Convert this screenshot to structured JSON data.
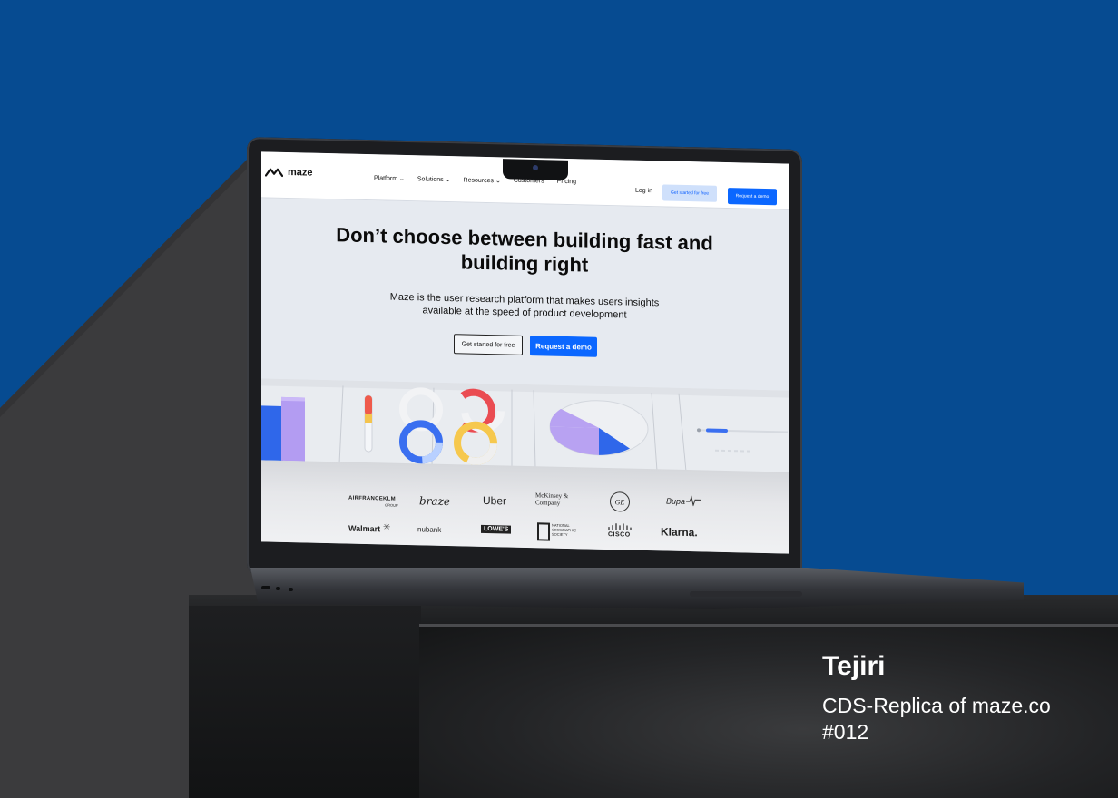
{
  "site": {
    "logo": "maze",
    "nav": [
      "Platform",
      "Solutions",
      "Resources",
      "Customers",
      "Pricing"
    ],
    "nav_dropdown_flags": [
      true,
      true,
      true,
      false,
      false
    ],
    "login": "Log in",
    "cta_ghost": "Get started for free",
    "cta_primary": "Request a demo",
    "hero_title_line1": "Don’t choose between building fast and",
    "hero_title_line2": "building right",
    "hero_sub_line1": "Maze is the user research platform that makes users insights",
    "hero_sub_line2": "available at the speed of product development",
    "hero_btn_outline": "Get started for free",
    "hero_btn_primary": "Request a  demo",
    "brands_row1": [
      "AIRFRANCEKLM",
      "braze",
      "Uber",
      "McKinsey & Company",
      "GE",
      "Bupa"
    ],
    "brands_row2": [
      "Walmart",
      "nubank",
      "LOWE'S",
      "NATIONAL GEOGRAPHIC SOCIETY",
      "CISCO",
      "Klarna."
    ],
    "brand_subtexts": {
      "airfrance": "GROUP"
    }
  },
  "caption": {
    "author": "Tejiri",
    "line1": "CDS-Replica of maze.co",
    "line2": "#012"
  },
  "colors": {
    "background": "#064b91",
    "accent": "#0b67ff",
    "screen_bg": "#e6eaf0"
  }
}
